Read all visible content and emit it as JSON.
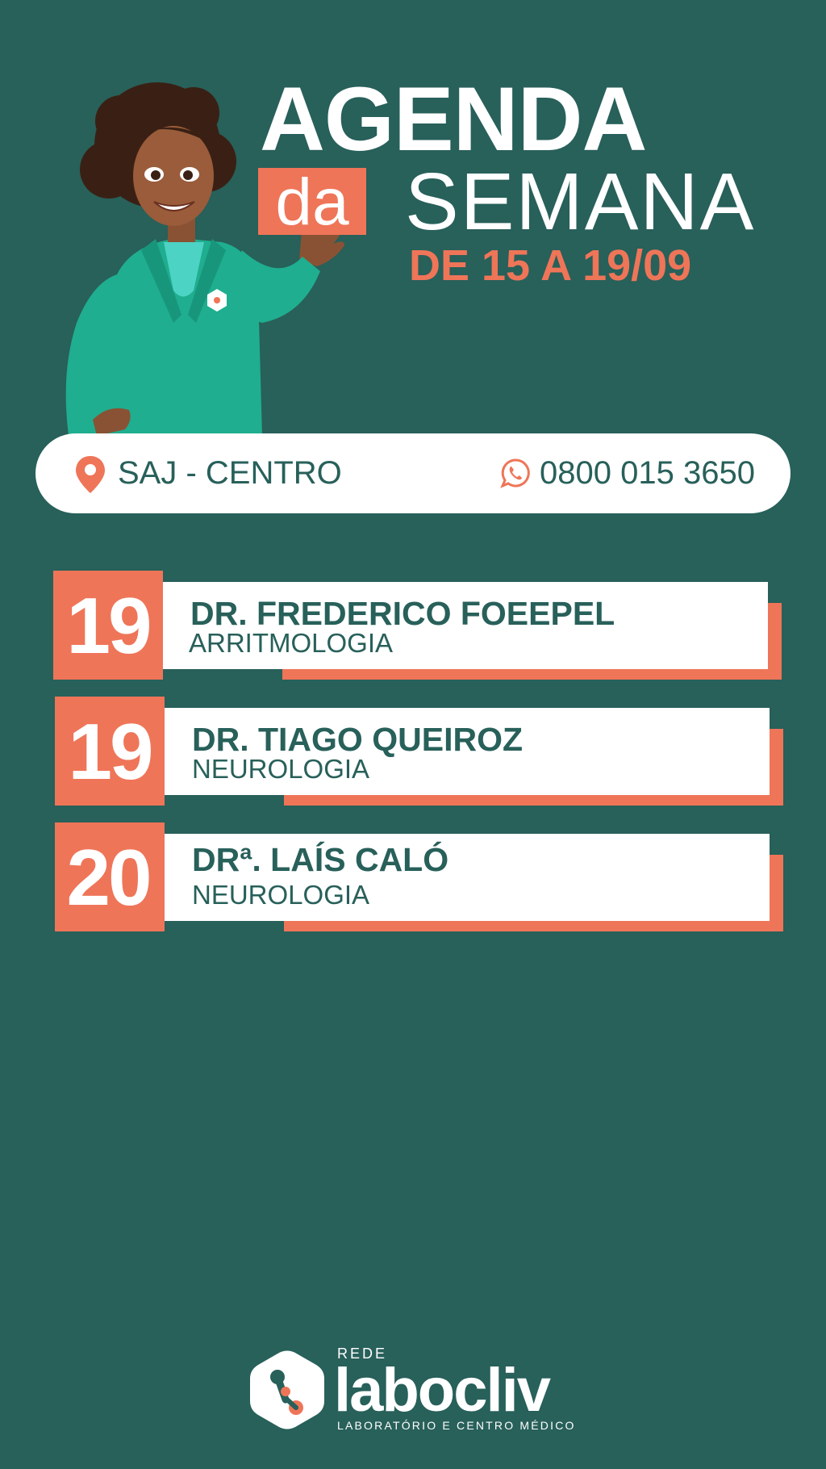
{
  "header": {
    "title": "AGENDA",
    "connector": "da",
    "subtitle": "SEMANA",
    "date_range": "DE 15 A 19/09"
  },
  "info": {
    "location": "SAJ - CENTRO",
    "phone": "0800 015 3650",
    "location_icon": "location-pin-icon",
    "phone_icon": "whatsapp-icon"
  },
  "schedule": [
    {
      "day": "19",
      "doctor": "DR. FREDERICO FOEEPEL",
      "specialty": "ARRITMOLOGIA"
    },
    {
      "day": "19",
      "doctor": "DR. TIAGO QUEIROZ",
      "specialty": "NEUROLOGIA"
    },
    {
      "day": "20",
      "doctor": "DRª. LAÍS CALÓ",
      "specialty": "NEUROLOGIA"
    }
  ],
  "brand": {
    "prefix": "REDE",
    "name": "labocliv",
    "tagline": "LABORATÓRIO E CENTRO MÉDICO"
  },
  "colors": {
    "background": "#28605A",
    "accent": "#EF7558",
    "card": "#FFFFFF",
    "mascot_jacket": "#1FAE8F"
  }
}
